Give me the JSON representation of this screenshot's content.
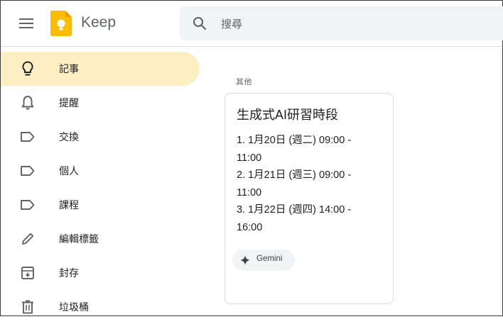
{
  "header": {
    "app_name": "Keep",
    "search_placeholder": "搜尋"
  },
  "sidebar": {
    "items": [
      {
        "label": "記事",
        "icon": "lightbulb-icon",
        "active": true
      },
      {
        "label": "提醒",
        "icon": "bell-icon"
      },
      {
        "label": "交換",
        "icon": "label-icon"
      },
      {
        "label": "個人",
        "icon": "label-icon"
      },
      {
        "label": "課程",
        "icon": "label-icon"
      },
      {
        "label": "編輯標籤",
        "icon": "pencil-icon"
      },
      {
        "label": "封存",
        "icon": "archive-icon"
      },
      {
        "label": "垃圾桶",
        "icon": "trash-icon"
      }
    ]
  },
  "main": {
    "section_title": "其他",
    "note": {
      "title": "生成式AI研習時段",
      "lines": [
        "1.  1月20日 (週二) 09:00 -",
        "11:00",
        "2.  1月21日 (週三) 09:00 -",
        "11:00",
        "3.  1月22日 (週四) 14:00 -",
        "16:00"
      ],
      "chip_label": "Gemini",
      "chip_icon": "sparkle-icon"
    }
  },
  "colors": {
    "active_bg": "#feefc3",
    "logo_yellow": "#fbbc04",
    "search_bg": "#f1f3f4"
  }
}
